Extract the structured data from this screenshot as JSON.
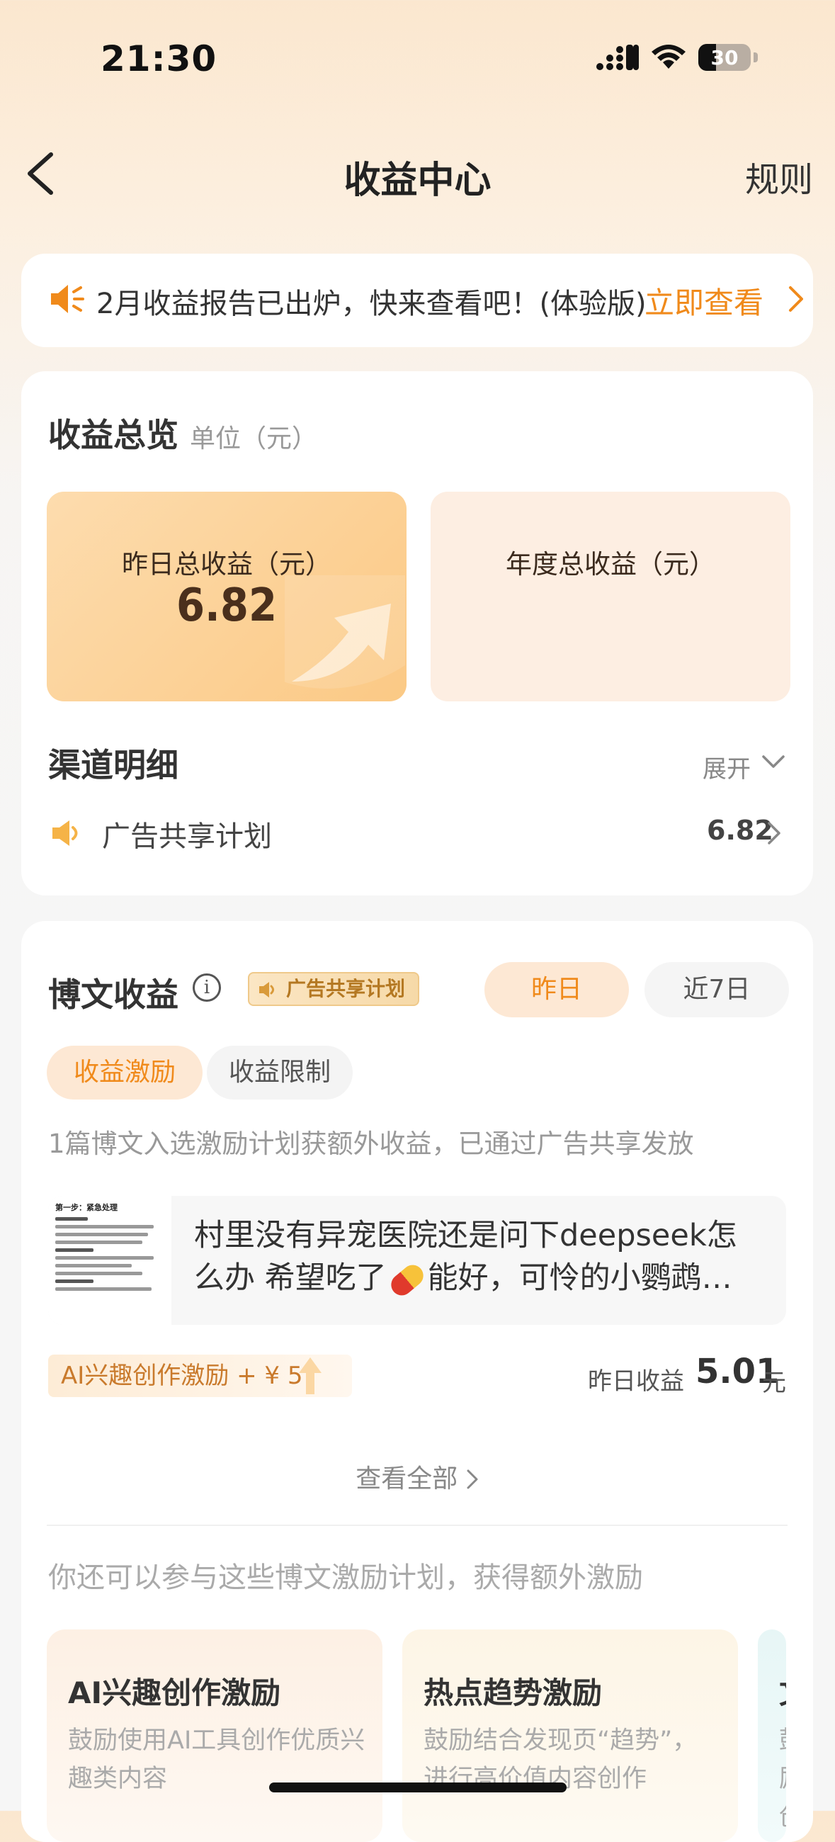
{
  "status_bar": {
    "time": "21:30",
    "battery": "30"
  },
  "nav": {
    "title": "收益中心",
    "rules": "规则"
  },
  "notice": {
    "text": "2月收益报告已出炉，快来查看吧！(体验版)",
    "link": "立即查看"
  },
  "overview": {
    "title": "收益总览",
    "unit": "单位（元）",
    "yesterday_label": "昨日总收益（元）",
    "yesterday_value": "6.82",
    "annual_label": "年度总收益（元）",
    "channels_title": "渠道明细",
    "expand": "展开",
    "channels": [
      {
        "label": "广告共享计划",
        "value": "6.82"
      }
    ]
  },
  "blog": {
    "title": "博文收益",
    "tag": "广告共享计划",
    "period_tabs": [
      "昨日",
      "近7日"
    ],
    "sub_tabs": [
      "收益激励",
      "收益限制"
    ],
    "description": "1篇博文入选激励计划获额外收益，已通过广告共享发放",
    "article": {
      "title_part1": "村里没有异宠医院还是问下deepseek怎么办 希望吃了",
      "title_part2": "能好，可怜的小鹦鹉…",
      "thumb_heading": "第一步：紧急处理"
    },
    "incentive": "AI兴趣创作激励 + ¥ 5",
    "yesterday_label": "昨日收益",
    "yesterday_value": "5.01",
    "yesterday_unit": "元",
    "see_all": "查看全部",
    "more_desc": "你还可以参与这些博文激励计划，获得额外激励",
    "plans": [
      {
        "title": "AI兴趣创作激励",
        "desc": "鼓励使用AI工具创作优质兴趣类内容"
      },
      {
        "title": "热点趋势激励",
        "desc": "鼓励结合发现页“趋势”，进行高价值内容创作"
      },
      {
        "title": "文",
        "desc": "鼓励创作"
      }
    ]
  },
  "colors": {
    "accent": "#f08a1b",
    "tile_primary": "#fbc985",
    "tile_secondary": "#fdeee2"
  }
}
